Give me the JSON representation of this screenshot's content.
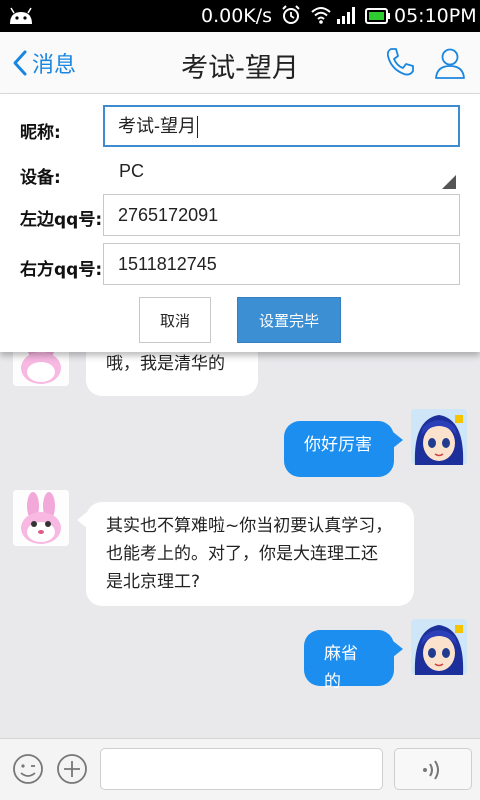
{
  "status_bar": {
    "network_speed": "0.00K/s",
    "time": "05:10PM"
  },
  "header": {
    "back_label": "消息",
    "title": "考试-望月"
  },
  "settings": {
    "nickname_label": "昵称:",
    "nickname_value": "考试-望月",
    "device_label": "设备:",
    "device_value": "PC",
    "left_qq_label": "左边qq号:",
    "left_qq_value": "2765172091",
    "right_qq_label": "右方qq号:",
    "right_qq_value": "1511812745",
    "cancel_label": "取消",
    "done_label": "设置完毕"
  },
  "messages": [
    {
      "side": "left",
      "text": "哦，我是清华的"
    },
    {
      "side": "right",
      "text": "你好厉害"
    },
    {
      "side": "left",
      "text": "其实也不算难啦~你当初要认真学习，也能考上的。对了，你是大连理工还是北京理工?"
    },
    {
      "side": "right",
      "text": "麻省的"
    }
  ],
  "icons": {
    "back": "chevron-left-icon",
    "phone": "phone-icon",
    "user": "user-icon",
    "emoji": "emoji-icon",
    "plus": "plus-icon",
    "voice": "voice-icon"
  },
  "colors": {
    "accent": "#1b8ef0",
    "done_button": "#3d8fd3",
    "background": "#e9e9ec"
  }
}
